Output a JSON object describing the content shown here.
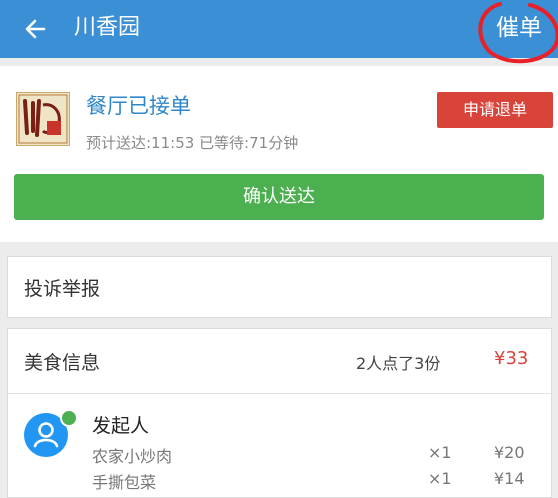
{
  "appbar": {
    "title": "川香园",
    "remind_label": "催单"
  },
  "restaurant": {
    "logo_text": "川香园"
  },
  "status": {
    "title": "餐厅已接单",
    "subtitle": "预计送达:11:53 已等待:71分钟",
    "refund_label": "申请退单",
    "confirm_label": "确认送达"
  },
  "complaint": {
    "label": "投诉举报"
  },
  "food": {
    "title": "美食信息",
    "summary": "2人点了3份",
    "total": "¥33",
    "initiator": "发起人",
    "items": [
      {
        "name": "农家小炒肉",
        "qty": "×1",
        "price": "¥20"
      },
      {
        "name": "手撕包菜",
        "qty": "×1",
        "price": "¥14"
      }
    ]
  },
  "colors": {
    "appbar": "#3b8fd4",
    "confirm": "#4caf50",
    "refund": "#d9443a",
    "accent_text": "#2f87c9"
  }
}
